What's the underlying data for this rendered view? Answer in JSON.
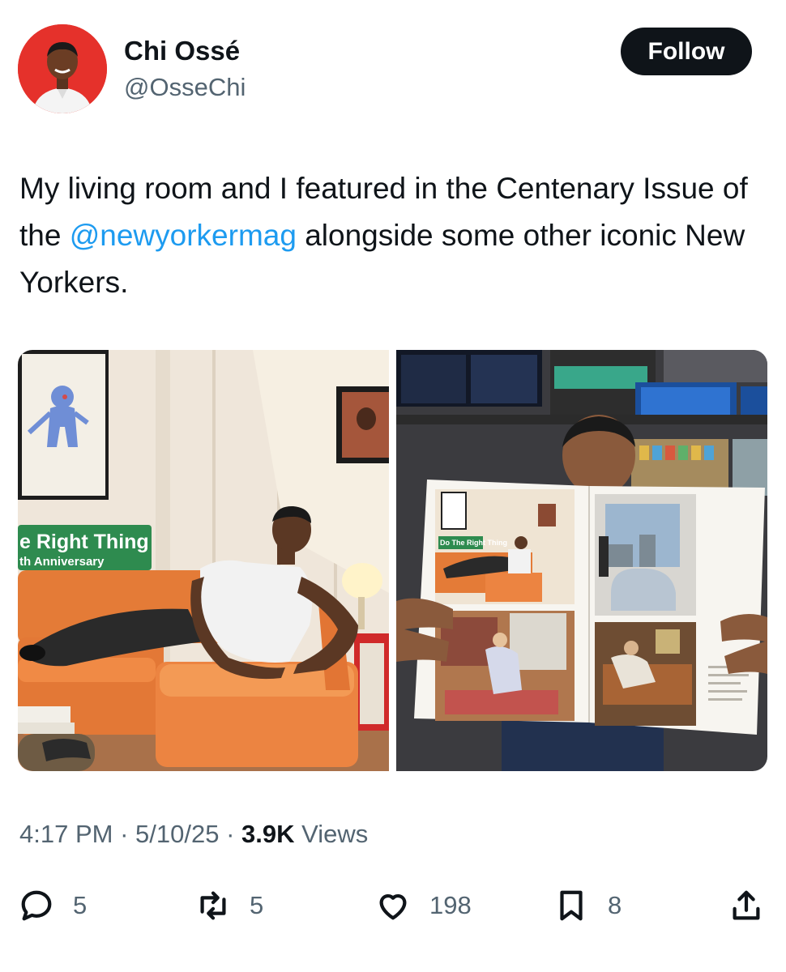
{
  "author": {
    "name": "Chi Ossé",
    "handle": "@OsseChi",
    "avatar_bg": "#e5312b"
  },
  "follow_label": "Follow",
  "tweet": {
    "text_before": "My living room and I featured in the Centenary Issue of the ",
    "mention": "@newyorkermag",
    "text_after": " alongside some other iconic New Yorkers."
  },
  "photos": {
    "left": {
      "sign_line1": "e Right Thing",
      "sign_line2": "th Anniversary"
    },
    "right": {
      "magazine_sign": "Do The Right Thing"
    }
  },
  "meta": {
    "time": "4:17 PM",
    "sep1": " · ",
    "date": "5/10/25",
    "sep2": " · ",
    "views_count": "3.9K",
    "views_label": " Views"
  },
  "actions": {
    "replies": "5",
    "reposts": "5",
    "likes": "198",
    "bookmarks": "8"
  },
  "icons": [
    "reply-icon",
    "repost-icon",
    "like-icon",
    "bookmark-icon",
    "share-icon"
  ]
}
